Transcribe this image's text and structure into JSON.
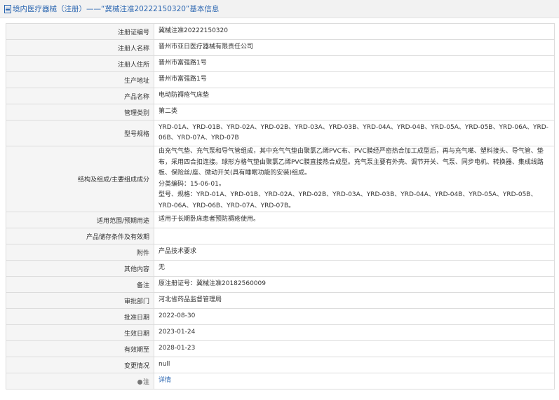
{
  "header": {
    "title": "境内医疗器械（注册）——“冀械注准20222150320”基本信息"
  },
  "rows": [
    {
      "label": "注册证编号",
      "value": "冀械注准20222150320"
    },
    {
      "label": "注册人名称",
      "value": "晋州市亚日医疗器械有限责任公司"
    },
    {
      "label": "注册人住所",
      "value": "晋州市富强路1号"
    },
    {
      "label": "生产地址",
      "value": "晋州市富强路1号"
    },
    {
      "label": "产品名称",
      "value": "电动防褥疮气床垫"
    },
    {
      "label": "管理类别",
      "value": "第二类"
    },
    {
      "label": "型号规格",
      "value": "YRD-01A、YRD-01B、YRD-02A、YRD-02B、YRD-03A、YRD-03B、YRD-04A、YRD-04B、YRD-05A、YRD-05B、YRD-06A、YRD-06B、YRD-07A、YRD-07B"
    },
    {
      "label": "结构及组成/主要组成成分",
      "value_lines": [
        "由充气气垫、充气泵和导气管组成，其中充气气垫由聚氯乙烯PVC布、PVC膜经严密热合加工成型后，再与充气嘴、塑料接头、导气管、垫布，采用四合扣连接。球形方格气垫由聚氯乙烯PVC膜直接热合成型。充气泵主要有外壳、调节开关、气泵、同步电机、转换器、集成线路板、保险丝/座、微动开关(具有睡眠功能的安装)组成。",
        "分类编码：15-06-01。",
        "型号、规格：YRD-01A、YRD-01B、YRD-02A、YRD-02B、YRD-03A、YRD-03B、YRD-04A、YRD-04B、YRD-05A、YRD-05B、YRD-06A、YRD-06B、YRD-07A、YRD-07B。"
      ]
    },
    {
      "label": "适用范围/预期用途",
      "value": "适用于长期卧床患者预防褥疮使用。"
    },
    {
      "label": "产品储存条件及有效期",
      "value": ""
    },
    {
      "label": "附件",
      "value": "产品技术要求"
    },
    {
      "label": "其他内容",
      "value": "无"
    },
    {
      "label": "备注",
      "value": "原注册证号：冀械注准20182560009"
    },
    {
      "label": "审批部门",
      "value": "河北省药品监督管理局"
    },
    {
      "label": "批准日期",
      "value": "2022-08-30"
    },
    {
      "label": "生效日期",
      "value": "2023-01-24"
    },
    {
      "label": "有效期至",
      "value": "2028-01-23"
    },
    {
      "label": "变更情况",
      "value": "null"
    },
    {
      "label": "注",
      "value": "详情",
      "label_icon": "info-dot-icon"
    }
  ]
}
